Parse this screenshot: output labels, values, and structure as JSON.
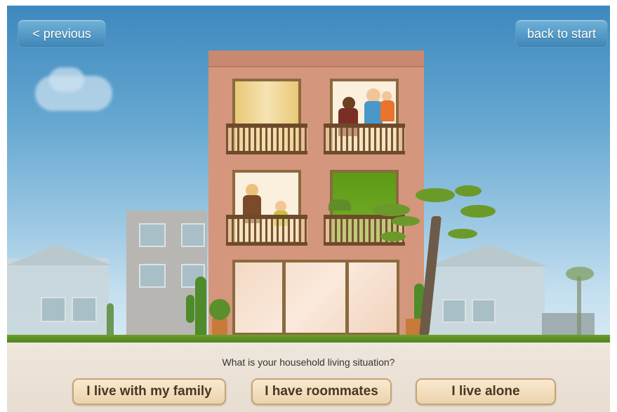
{
  "nav": {
    "previous_label": "< previous",
    "back_label": "back to start"
  },
  "question": "What is your household living situation?",
  "answers": [
    {
      "label": "I live with my family"
    },
    {
      "label": "I have roommates"
    },
    {
      "label": "I live alone"
    }
  ],
  "colors": {
    "sky_top": "#3d88be",
    "building": "#d4967c",
    "nav_button": "#4d93c3",
    "answer_button": "#f3dfbf",
    "grass": "#5c8f24"
  },
  "icons": [
    "cloud-icon",
    "building-illustration",
    "tree-icon",
    "cactus-icon",
    "potted-plant-icon"
  ]
}
